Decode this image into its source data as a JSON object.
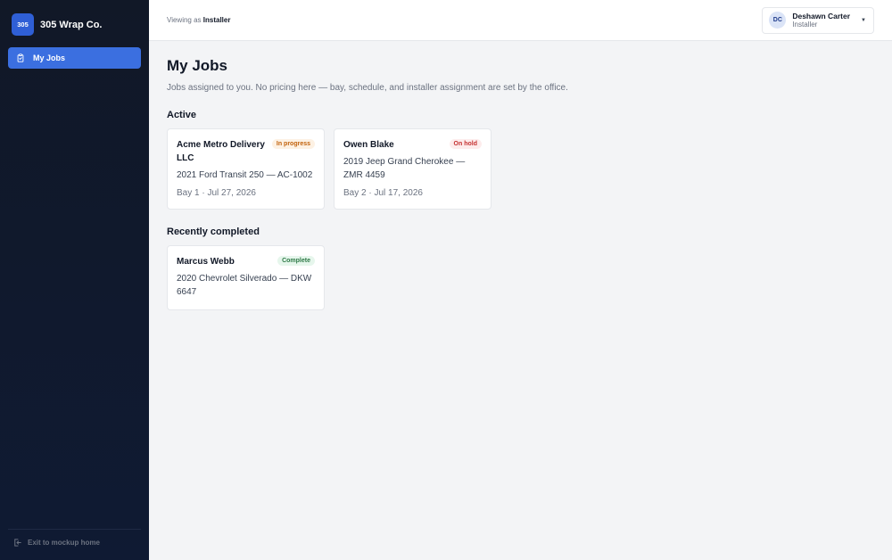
{
  "sidebar": {
    "logo_text": "305",
    "brand_name": "305 Wrap Co.",
    "nav": [
      {
        "label": "My Jobs",
        "icon": "clipboard-icon",
        "active": true
      }
    ],
    "footer_label": "Exit to mockup home",
    "footer_icon": "exit-icon"
  },
  "topbar": {
    "viewing_prefix": "Viewing as",
    "viewing_role": "Installer",
    "user": {
      "initials": "DC",
      "name": "Deshawn Carter",
      "role": "Installer"
    }
  },
  "main": {
    "title": "My Jobs",
    "subtitle": "Jobs assigned to you. No pricing here — bay, schedule, and installer assignment are set by the office.",
    "active_heading": "Active",
    "completed_heading": "Recently completed",
    "active_jobs": [
      {
        "name": "Acme Metro Delivery LLC",
        "status": "In progress",
        "vehicle": "2021 Ford Transit 250 — AC-1002",
        "meta": "Bay 1 · Jul 27, 2026"
      },
      {
        "name": "Owen Blake",
        "status": "On hold",
        "vehicle": "2019 Jeep Grand Cherokee — ZMR 4459",
        "meta": "Bay 2 · Jul 17, 2026"
      }
    ],
    "completed_jobs": [
      {
        "name": "Marcus Webb",
        "status": "Complete",
        "vehicle": "2020 Chevrolet Silverado — DKW 6647"
      }
    ]
  },
  "colors": {
    "sidebar_bg": "#111827",
    "accent": "#3b6fe0",
    "in_progress": "#c2620c",
    "on_hold": "#c53030",
    "complete": "#2f7a47"
  }
}
